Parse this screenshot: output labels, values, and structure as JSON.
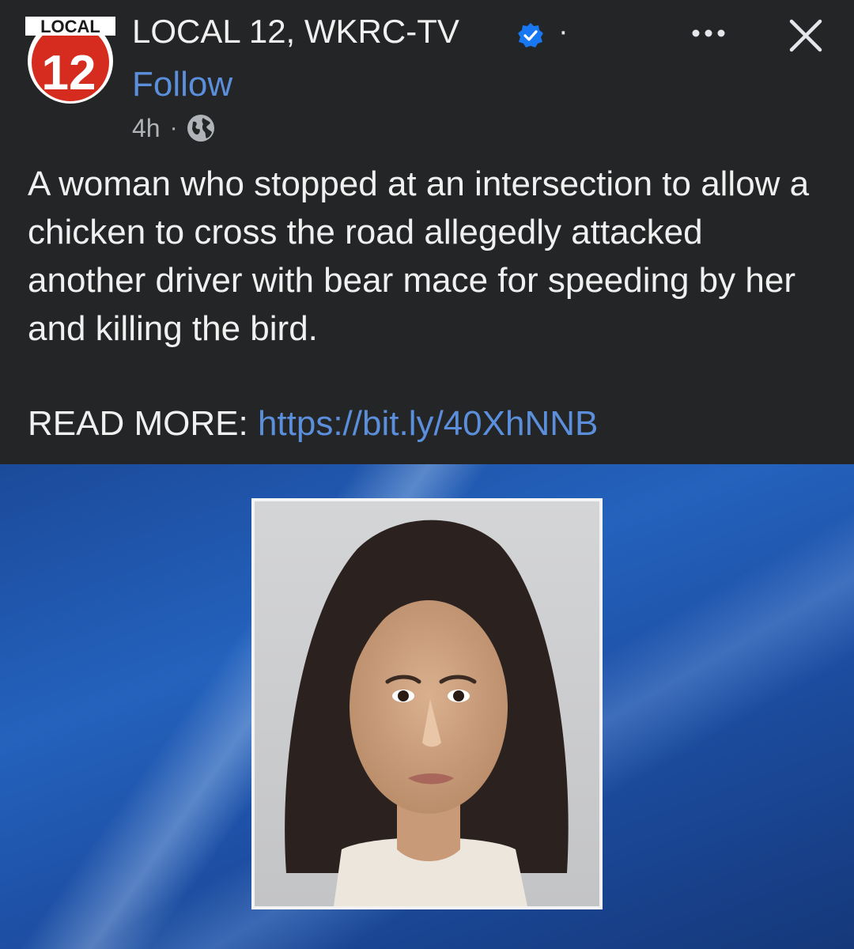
{
  "post": {
    "page_name": "LOCAL 12, WKRC-TV",
    "verified_icon": "verified-badge-icon",
    "name_separator": "·",
    "follow_label": "Follow",
    "time": "4h",
    "meta_separator": "·",
    "audience_icon": "globe-icon",
    "body": "A woman who stopped at an intersection to allow a chicken to cross the road allegedly attacked another driver with bear mace for speeding by her and killing the bird.",
    "read_more_label": "READ MORE:",
    "link": "https://bit.ly/40XhNNB"
  },
  "avatar": {
    "logo_top_text": "LOCAL",
    "logo_number": "12"
  },
  "actions": {
    "more_icon": "more-options-icon",
    "close_icon": "close-icon"
  },
  "colors": {
    "background": "#242526",
    "link": "#5b8fdb",
    "verified": "#1877f2",
    "logo_red": "#d62b1f",
    "media_blue": "#2462bd"
  }
}
